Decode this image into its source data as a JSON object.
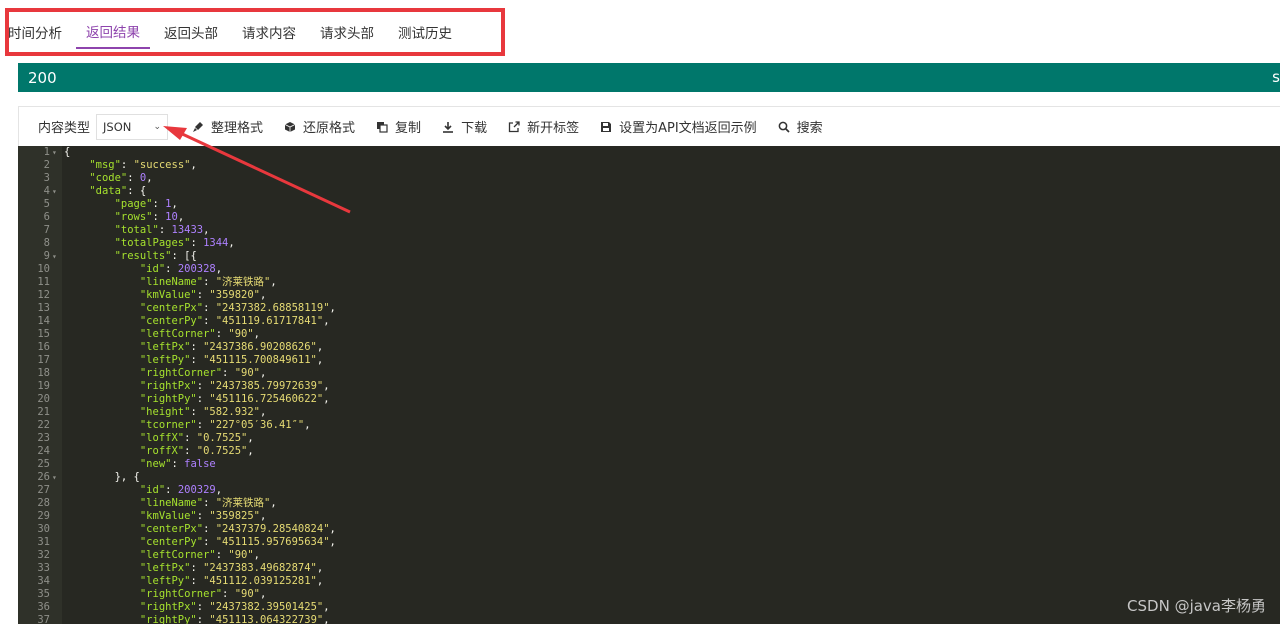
{
  "tabs": [
    {
      "label": "时间分析",
      "active": false
    },
    {
      "label": "返回结果",
      "active": true
    },
    {
      "label": "返回头部",
      "active": false
    },
    {
      "label": "请求内容",
      "active": false
    },
    {
      "label": "请求头部",
      "active": false
    },
    {
      "label": "测试历史",
      "active": false
    }
  ],
  "status": {
    "code": "200",
    "right_text": "s"
  },
  "toolbar": {
    "content_type_label": "内容类型",
    "content_type_value": "JSON",
    "format": "整理格式",
    "restore": "还原格式",
    "copy": "复制",
    "download": "下载",
    "new_tab": "新开标签",
    "set_example": "设置为API文档返回示例",
    "search": "搜索"
  },
  "code_lines": [
    [
      {
        "t": "p",
        "v": "{"
      }
    ],
    [
      {
        "t": "p",
        "v": "    "
      },
      {
        "t": "k",
        "v": "\"msg\""
      },
      {
        "t": "p",
        "v": ": "
      },
      {
        "t": "s",
        "v": "\"success\""
      },
      {
        "t": "p",
        "v": ","
      }
    ],
    [
      {
        "t": "p",
        "v": "    "
      },
      {
        "t": "k",
        "v": "\"code\""
      },
      {
        "t": "p",
        "v": ": "
      },
      {
        "t": "n",
        "v": "0"
      },
      {
        "t": "p",
        "v": ","
      }
    ],
    [
      {
        "t": "p",
        "v": "    "
      },
      {
        "t": "k",
        "v": "\"data\""
      },
      {
        "t": "p",
        "v": ": {"
      }
    ],
    [
      {
        "t": "p",
        "v": "        "
      },
      {
        "t": "k",
        "v": "\"page\""
      },
      {
        "t": "p",
        "v": ": "
      },
      {
        "t": "n",
        "v": "1"
      },
      {
        "t": "p",
        "v": ","
      }
    ],
    [
      {
        "t": "p",
        "v": "        "
      },
      {
        "t": "k",
        "v": "\"rows\""
      },
      {
        "t": "p",
        "v": ": "
      },
      {
        "t": "n",
        "v": "10"
      },
      {
        "t": "p",
        "v": ","
      }
    ],
    [
      {
        "t": "p",
        "v": "        "
      },
      {
        "t": "k",
        "v": "\"total\""
      },
      {
        "t": "p",
        "v": ": "
      },
      {
        "t": "n",
        "v": "13433"
      },
      {
        "t": "p",
        "v": ","
      }
    ],
    [
      {
        "t": "p",
        "v": "        "
      },
      {
        "t": "k",
        "v": "\"totalPages\""
      },
      {
        "t": "p",
        "v": ": "
      },
      {
        "t": "n",
        "v": "1344"
      },
      {
        "t": "p",
        "v": ","
      }
    ],
    [
      {
        "t": "p",
        "v": "        "
      },
      {
        "t": "k",
        "v": "\"results\""
      },
      {
        "t": "p",
        "v": ": [{"
      }
    ],
    [
      {
        "t": "p",
        "v": "            "
      },
      {
        "t": "k",
        "v": "\"id\""
      },
      {
        "t": "p",
        "v": ": "
      },
      {
        "t": "n",
        "v": "200328"
      },
      {
        "t": "p",
        "v": ","
      }
    ],
    [
      {
        "t": "p",
        "v": "            "
      },
      {
        "t": "k",
        "v": "\"lineName\""
      },
      {
        "t": "p",
        "v": ": "
      },
      {
        "t": "s",
        "v": "\"济莱铁路\""
      },
      {
        "t": "p",
        "v": ","
      }
    ],
    [
      {
        "t": "p",
        "v": "            "
      },
      {
        "t": "k",
        "v": "\"kmValue\""
      },
      {
        "t": "p",
        "v": ": "
      },
      {
        "t": "s",
        "v": "\"359820\""
      },
      {
        "t": "p",
        "v": ","
      }
    ],
    [
      {
        "t": "p",
        "v": "            "
      },
      {
        "t": "k",
        "v": "\"centerPx\""
      },
      {
        "t": "p",
        "v": ": "
      },
      {
        "t": "s",
        "v": "\"2437382.68858119\""
      },
      {
        "t": "p",
        "v": ","
      }
    ],
    [
      {
        "t": "p",
        "v": "            "
      },
      {
        "t": "k",
        "v": "\"centerPy\""
      },
      {
        "t": "p",
        "v": ": "
      },
      {
        "t": "s",
        "v": "\"451119.61717841\""
      },
      {
        "t": "p",
        "v": ","
      }
    ],
    [
      {
        "t": "p",
        "v": "            "
      },
      {
        "t": "k",
        "v": "\"leftCorner\""
      },
      {
        "t": "p",
        "v": ": "
      },
      {
        "t": "s",
        "v": "\"90\""
      },
      {
        "t": "p",
        "v": ","
      }
    ],
    [
      {
        "t": "p",
        "v": "            "
      },
      {
        "t": "k",
        "v": "\"leftPx\""
      },
      {
        "t": "p",
        "v": ": "
      },
      {
        "t": "s",
        "v": "\"2437386.90208626\""
      },
      {
        "t": "p",
        "v": ","
      }
    ],
    [
      {
        "t": "p",
        "v": "            "
      },
      {
        "t": "k",
        "v": "\"leftPy\""
      },
      {
        "t": "p",
        "v": ": "
      },
      {
        "t": "s",
        "v": "\"451115.700849611\""
      },
      {
        "t": "p",
        "v": ","
      }
    ],
    [
      {
        "t": "p",
        "v": "            "
      },
      {
        "t": "k",
        "v": "\"rightCorner\""
      },
      {
        "t": "p",
        "v": ": "
      },
      {
        "t": "s",
        "v": "\"90\""
      },
      {
        "t": "p",
        "v": ","
      }
    ],
    [
      {
        "t": "p",
        "v": "            "
      },
      {
        "t": "k",
        "v": "\"rightPx\""
      },
      {
        "t": "p",
        "v": ": "
      },
      {
        "t": "s",
        "v": "\"2437385.79972639\""
      },
      {
        "t": "p",
        "v": ","
      }
    ],
    [
      {
        "t": "p",
        "v": "            "
      },
      {
        "t": "k",
        "v": "\"rightPy\""
      },
      {
        "t": "p",
        "v": ": "
      },
      {
        "t": "s",
        "v": "\"451116.725460622\""
      },
      {
        "t": "p",
        "v": ","
      }
    ],
    [
      {
        "t": "p",
        "v": "            "
      },
      {
        "t": "k",
        "v": "\"height\""
      },
      {
        "t": "p",
        "v": ": "
      },
      {
        "t": "s",
        "v": "\"582.932\""
      },
      {
        "t": "p",
        "v": ","
      }
    ],
    [
      {
        "t": "p",
        "v": "            "
      },
      {
        "t": "k",
        "v": "\"tcorner\""
      },
      {
        "t": "p",
        "v": ": "
      },
      {
        "t": "s",
        "v": "\"227°05′36.41″\""
      },
      {
        "t": "p",
        "v": ","
      }
    ],
    [
      {
        "t": "p",
        "v": "            "
      },
      {
        "t": "k",
        "v": "\"loffX\""
      },
      {
        "t": "p",
        "v": ": "
      },
      {
        "t": "s",
        "v": "\"0.7525\""
      },
      {
        "t": "p",
        "v": ","
      }
    ],
    [
      {
        "t": "p",
        "v": "            "
      },
      {
        "t": "k",
        "v": "\"roffX\""
      },
      {
        "t": "p",
        "v": ": "
      },
      {
        "t": "s",
        "v": "\"0.7525\""
      },
      {
        "t": "p",
        "v": ","
      }
    ],
    [
      {
        "t": "p",
        "v": "            "
      },
      {
        "t": "k",
        "v": "\"new\""
      },
      {
        "t": "p",
        "v": ": "
      },
      {
        "t": "b",
        "v": "false"
      }
    ],
    [
      {
        "t": "p",
        "v": "        }, {"
      }
    ],
    [
      {
        "t": "p",
        "v": "            "
      },
      {
        "t": "k",
        "v": "\"id\""
      },
      {
        "t": "p",
        "v": ": "
      },
      {
        "t": "n",
        "v": "200329"
      },
      {
        "t": "p",
        "v": ","
      }
    ],
    [
      {
        "t": "p",
        "v": "            "
      },
      {
        "t": "k",
        "v": "\"lineName\""
      },
      {
        "t": "p",
        "v": ": "
      },
      {
        "t": "s",
        "v": "\"济莱铁路\""
      },
      {
        "t": "p",
        "v": ","
      }
    ],
    [
      {
        "t": "p",
        "v": "            "
      },
      {
        "t": "k",
        "v": "\"kmValue\""
      },
      {
        "t": "p",
        "v": ": "
      },
      {
        "t": "s",
        "v": "\"359825\""
      },
      {
        "t": "p",
        "v": ","
      }
    ],
    [
      {
        "t": "p",
        "v": "            "
      },
      {
        "t": "k",
        "v": "\"centerPx\""
      },
      {
        "t": "p",
        "v": ": "
      },
      {
        "t": "s",
        "v": "\"2437379.28540824\""
      },
      {
        "t": "p",
        "v": ","
      }
    ],
    [
      {
        "t": "p",
        "v": "            "
      },
      {
        "t": "k",
        "v": "\"centerPy\""
      },
      {
        "t": "p",
        "v": ": "
      },
      {
        "t": "s",
        "v": "\"451115.957695634\""
      },
      {
        "t": "p",
        "v": ","
      }
    ],
    [
      {
        "t": "p",
        "v": "            "
      },
      {
        "t": "k",
        "v": "\"leftCorner\""
      },
      {
        "t": "p",
        "v": ": "
      },
      {
        "t": "s",
        "v": "\"90\""
      },
      {
        "t": "p",
        "v": ","
      }
    ],
    [
      {
        "t": "p",
        "v": "            "
      },
      {
        "t": "k",
        "v": "\"leftPx\""
      },
      {
        "t": "p",
        "v": ": "
      },
      {
        "t": "s",
        "v": "\"2437383.49682874\""
      },
      {
        "t": "p",
        "v": ","
      }
    ],
    [
      {
        "t": "p",
        "v": "            "
      },
      {
        "t": "k",
        "v": "\"leftPy\""
      },
      {
        "t": "p",
        "v": ": "
      },
      {
        "t": "s",
        "v": "\"451112.039125281\""
      },
      {
        "t": "p",
        "v": ","
      }
    ],
    [
      {
        "t": "p",
        "v": "            "
      },
      {
        "t": "k",
        "v": "\"rightCorner\""
      },
      {
        "t": "p",
        "v": ": "
      },
      {
        "t": "s",
        "v": "\"90\""
      },
      {
        "t": "p",
        "v": ","
      }
    ],
    [
      {
        "t": "p",
        "v": "            "
      },
      {
        "t": "k",
        "v": "\"rightPx\""
      },
      {
        "t": "p",
        "v": ": "
      },
      {
        "t": "s",
        "v": "\"2437382.39501425\""
      },
      {
        "t": "p",
        "v": ","
      }
    ],
    [
      {
        "t": "p",
        "v": "            "
      },
      {
        "t": "k",
        "v": "\"rightPy\""
      },
      {
        "t": "p",
        "v": ": "
      },
      {
        "t": "s",
        "v": "\"451113.064322739\""
      },
      {
        "t": "p",
        "v": ","
      }
    ]
  ],
  "fold_lines": [
    1,
    4,
    9,
    26
  ],
  "watermark": "CSDN @java李杨勇",
  "colors": {
    "accent": "#8e44ad",
    "status_bg": "#00776b",
    "annotation": "#e8383d",
    "editor_bg": "#272822"
  }
}
